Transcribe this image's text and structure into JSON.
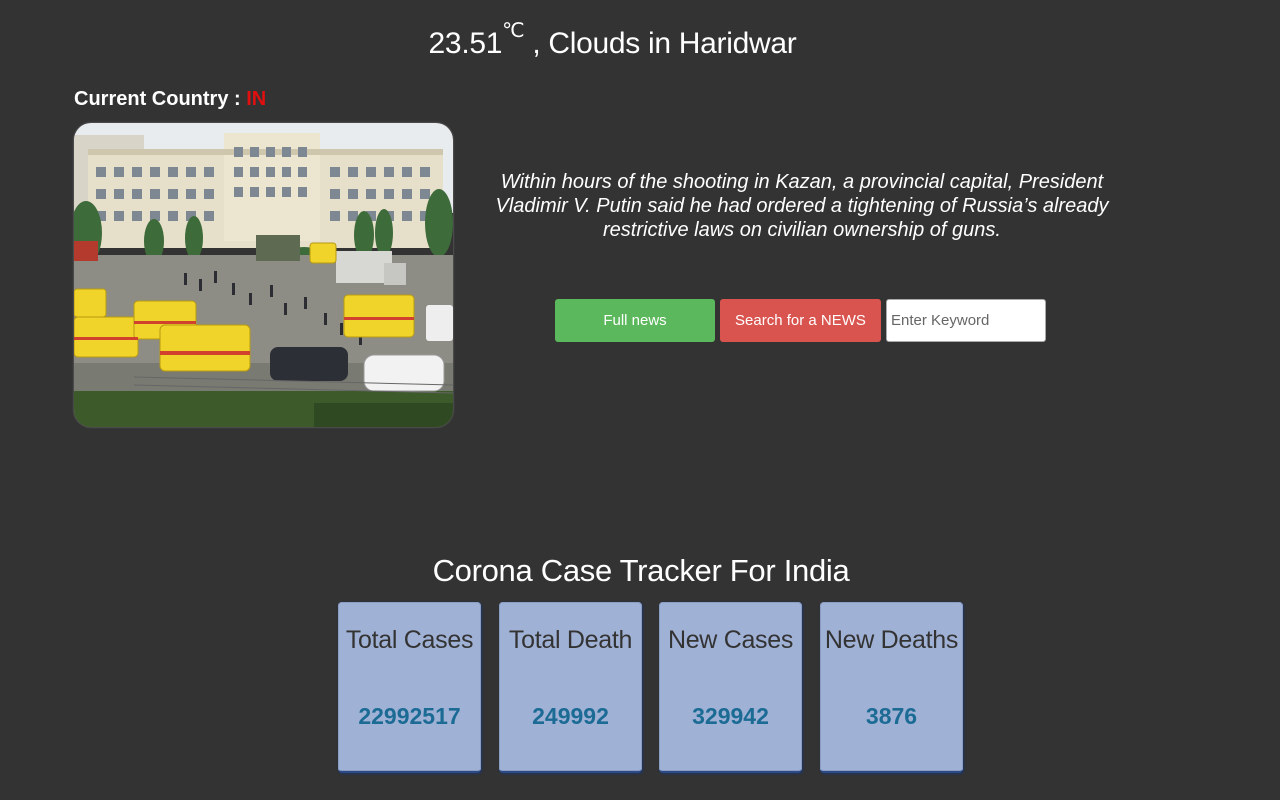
{
  "weather": {
    "temperature": "23.51",
    "unit": "℃",
    "condition_text": " , Clouds in Haridwar"
  },
  "country": {
    "label": "Current Country : ",
    "code": "IN"
  },
  "news": {
    "headline": "Within hours of the shooting in Kazan, a provincial capital, President Vladimir V. Putin said he had ordered a tightening of Russia’s already restrictive laws on civilian ownership of guns.",
    "full_news_label": "Full news",
    "search_label": "Search for a NEWS",
    "keyword_placeholder": "Enter Keyword",
    "keyword_value": ""
  },
  "tracker": {
    "title": "Corona Case Tracker For India",
    "cards": [
      {
        "label": "Total Cases",
        "value": "22992517"
      },
      {
        "label": "Total Death",
        "value": "249992"
      },
      {
        "label": "New Cases",
        "value": "329942"
      },
      {
        "label": "New Deaths",
        "value": "3876"
      }
    ]
  },
  "colors": {
    "background": "#333333",
    "country_code": "#e01010",
    "full_news_button": "#5cb85c",
    "search_button": "#d9534f",
    "card_background": "#a0b1d6",
    "card_value": "#1b6b94"
  }
}
